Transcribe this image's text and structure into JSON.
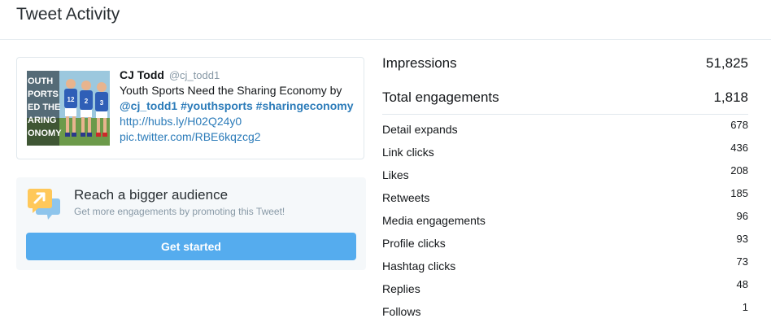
{
  "header": {
    "title": "Tweet Activity"
  },
  "tweet": {
    "author": "CJ Todd",
    "handle": "@cj_todd1",
    "text": "Youth Sports Need the Sharing Economy by",
    "tags": "@cj_todd1 #youthsports #sharingeconomy",
    "link1": "http://hubs.ly/H02Q24y0",
    "link2": "pic.twitter.com/RBE6kqzcg2",
    "thumbnail": {
      "text_lines": [
        "OUTH",
        "PORTS",
        "ED THE",
        "ARING",
        "ONOMY"
      ],
      "jersey_numbers": [
        "12",
        "2",
        "3"
      ]
    }
  },
  "promote": {
    "icon": "megaphone-arrow-icon",
    "title": "Reach a bigger audience",
    "subtitle": "Get more engagements by promoting this Tweet!",
    "button_label": "Get started",
    "accent": "#55acee"
  },
  "stats": {
    "impressions": {
      "label": "Impressions",
      "value": "51,825"
    },
    "engagements": {
      "label": "Total engagements",
      "value": "1,818"
    },
    "metrics": [
      {
        "label": "Detail expands",
        "value": "678"
      },
      {
        "label": "Link clicks",
        "value": "436"
      },
      {
        "label": "Likes",
        "value": "208"
      },
      {
        "label": "Retweets",
        "value": "185"
      },
      {
        "label": "Media engagements",
        "value": "96"
      },
      {
        "label": "Profile clicks",
        "value": "93"
      },
      {
        "label": "Hashtag clicks",
        "value": "73"
      },
      {
        "label": "Replies",
        "value": "48"
      },
      {
        "label": "Follows",
        "value": "1"
      }
    ]
  }
}
